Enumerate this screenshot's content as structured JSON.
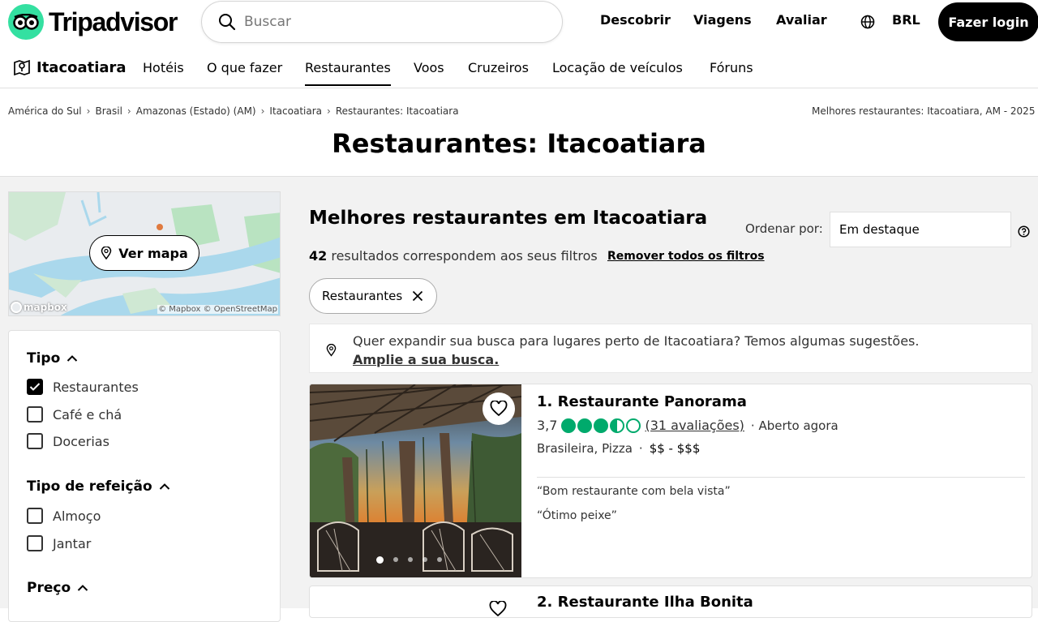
{
  "header": {
    "logo_text": "Tripadvisor",
    "search_placeholder": "Buscar",
    "nav": [
      "Descobrir",
      "Viagens",
      "Avaliar"
    ],
    "currency": "BRL",
    "login": "Fazer login"
  },
  "subnav": {
    "city": "Itacoatiara",
    "items": [
      "Hotéis",
      "O que fazer",
      "Restaurantes",
      "Voos",
      "Cruzeiros",
      "Locação de veículos",
      "Fóruns"
    ],
    "active": "Restaurantes"
  },
  "breadcrumb": {
    "items": [
      "América do Sul",
      "Brasil",
      "Amazonas (Estado) (AM)",
      "Itacoatiara",
      "Restaurantes: Itacoatiara"
    ],
    "right_text": "Melhores restaurantes: Itacoatiara, AM - 2025"
  },
  "page_title": "Restaurantes: Itacoatiara",
  "map": {
    "button": "Ver mapa",
    "mapbox_label": "mapbox",
    "credit": "© Mapbox © OpenStreetMap"
  },
  "filters": {
    "groups": [
      {
        "title": "Tipo",
        "options": [
          {
            "label": "Restaurantes",
            "checked": true
          },
          {
            "label": "Café e chá",
            "checked": false
          },
          {
            "label": "Docerias",
            "checked": false
          }
        ]
      },
      {
        "title": "Tipo de refeição",
        "options": [
          {
            "label": "Almoço",
            "checked": false
          },
          {
            "label": "Jantar",
            "checked": false
          }
        ]
      },
      {
        "title": "Preço",
        "options": []
      }
    ]
  },
  "main": {
    "heading": "Melhores restaurantes em Itacoatiara",
    "sort_label": "Ordenar por:",
    "sort_value": "Em destaque",
    "results_count": "42",
    "results_text": "resultados correspondem aos seus filtros",
    "remove_filters": "Remover todos os filtros",
    "chip": "Restaurantes",
    "suggestion_text": "Quer expandir sua busca para lugares perto de Itacoatiara? Temos algumas sugestões.",
    "suggestion_link": "Amplie a sua busca."
  },
  "listings": [
    {
      "title": "1. Restaurante Panorama",
      "rating": "3,7",
      "bubbles": 3.5,
      "reviews": "(31 avaliações)",
      "status": "Aberto agora",
      "cuisine": "Brasileira, Pizza",
      "price": "$$ - $$$",
      "quotes": [
        "“Bom restaurante com bela vista”",
        "“Ótimo peixe”"
      ],
      "photo_count": 5,
      "photo_index": 1
    },
    {
      "title": "2. Restaurante Ilha Bonita"
    }
  ],
  "colors": {
    "brand_green": "#34e0a1",
    "rating_green": "#00aa6c",
    "background_gray": "#f2f2f2"
  }
}
